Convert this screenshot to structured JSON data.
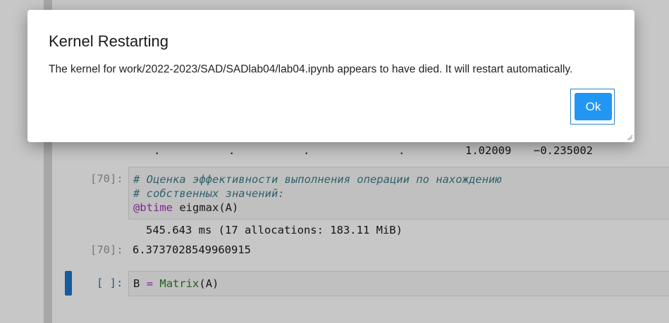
{
  "notebook": {
    "output_row": {
      "dots": [
        ".",
        ".",
        ".",
        "."
      ],
      "values": [
        "1.02009",
        "−0.235002"
      ]
    },
    "cell1": {
      "in_prompt": "[70]:",
      "code_lines": [
        "# Оценка эффективности выполнения операции по нахождению",
        "# собственных значений:"
      ],
      "macro": "@btime",
      "call_fn": "eigmax",
      "call_args": "(A)",
      "stdout": "545.643 ms (17 allocations: 183.11 MiB)",
      "out_prompt": "[70]:",
      "result": "6.3737028549960915"
    },
    "cell2": {
      "in_prompt": "[ ]:",
      "lhs": "B",
      "op": "=",
      "fn": "Matrix",
      "args": "(A)"
    }
  },
  "dialog": {
    "title": "Kernel Restarting",
    "message": "The kernel for work/2022-2023/SAD/SADlab04/lab04.ipynb appears to have died. It will restart automatically.",
    "ok_label": "Ok"
  },
  "colors": {
    "ok_button": "#2196f3",
    "active_cell_bar": "#1d76c8",
    "comment": "#3f7f89",
    "macro": "#a233b8"
  }
}
